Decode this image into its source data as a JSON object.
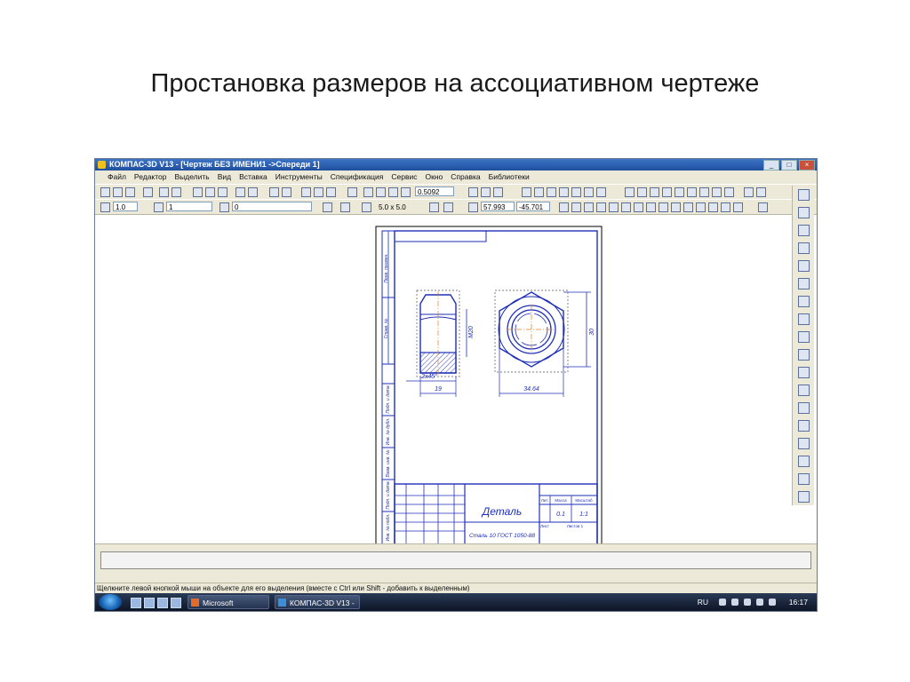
{
  "slide": {
    "title": "Простановка размеров на ассоциативном чертеже"
  },
  "window": {
    "title": "КОМПАС-3D V13 - [Чертеж БЕЗ ИМЕНИ1 ->Спереди 1]",
    "buttons": [
      "_",
      "□",
      "×"
    ]
  },
  "menu": [
    "Файл",
    "Редактор",
    "Выделить",
    "Вид",
    "Вставка",
    "Инструменты",
    "Спецификация",
    "Сервис",
    "Окно",
    "Справка",
    "Библиотеки"
  ],
  "toolbar1": {
    "zoom_value": "0.5092"
  },
  "toolbar2": {
    "line_width": "1.0",
    "layer": "1",
    "style": "0",
    "grid_step": "5.0 x 5.0",
    "coord_x": "57.993",
    "coord_y": "-45.701"
  },
  "drawing": {
    "dim_thread": "M20",
    "dim_across_flats": "30",
    "dim_height": "19",
    "dim_chamfer": "2x45°",
    "dim_width": "34.64",
    "title_block_name": "Деталь",
    "title_block_material": "Сталь 10 ГОСТ 1050-88",
    "title_block_mass": "0.1",
    "title_block_scale": "1:1",
    "title_block_headers": [
      "Лит.",
      "Масса",
      "Масштаб"
    ],
    "title_block_sheet": "Лист",
    "title_block_sheets": "Листов 1",
    "side_labels": [
      "Перв. примен.",
      "Справ. №",
      "Подп. и дата",
      "Инв. № дубл.",
      "Взам. инв. №",
      "Подп. и дата",
      "Инв. № подл."
    ]
  },
  "status": {
    "hint": "Щелкните левой кнопкой мыши на объекте для его выделения (вместе с Ctrl или Shift - добавить к выделенным)"
  },
  "taskbar": {
    "items": [
      "Microsoft PowerPoi...",
      "КОМПАС-3D V13 - ..."
    ],
    "lang": "RU",
    "time": "16:17"
  },
  "colors": {
    "drawing_blue": "#1f2fb8",
    "frame": "#000000",
    "axis": "#e08020"
  }
}
